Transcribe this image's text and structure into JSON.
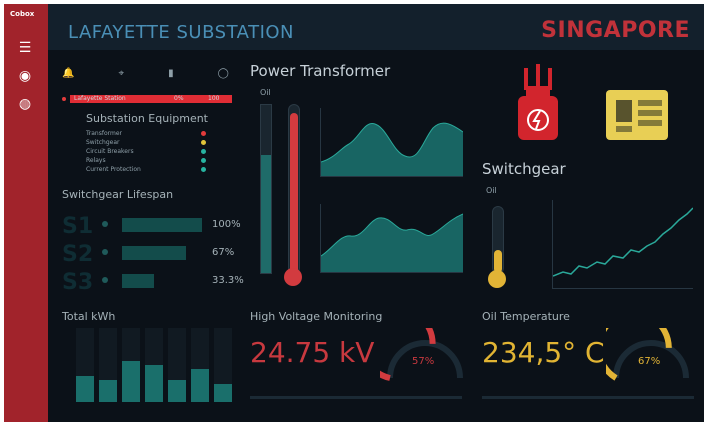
{
  "app": {
    "brand": "Cobox",
    "site_title": "LAFAYETTE SUBSTATION",
    "city": "SINGAPORE"
  },
  "sidebar": {
    "icons": [
      "menu-icon",
      "dashboard-icon",
      "user-icon"
    ]
  },
  "alarms": {
    "header_icons": [
      "bell-icon",
      "location-icon",
      "battery-icon",
      "bulb-icon"
    ],
    "active_row": {
      "name": "Lafayette Station",
      "c1": "0%",
      "c2": "100"
    }
  },
  "substation_equipment": {
    "title": "Substation Equipment",
    "items": [
      {
        "label": "Transformer",
        "color": "#e23b3b"
      },
      {
        "label": "Switchgear",
        "color": "#e0c43a"
      },
      {
        "label": "Circuit Breakers",
        "color": "#27b3a0"
      },
      {
        "label": "Relays",
        "color": "#27b3a0"
      },
      {
        "label": "Current Protection",
        "color": "#27b3a0"
      }
    ]
  },
  "switchgear_lifespan": {
    "title": "Switchgear Lifespan",
    "rows": [
      {
        "id": "S1",
        "value": "100%",
        "fraction": 1.0
      },
      {
        "id": "S2",
        "value": "67%",
        "fraction": 0.67
      },
      {
        "id": "S3",
        "value": "33.3%",
        "fraction": 0.33
      }
    ]
  },
  "total_kwh": {
    "title": "Total kWh",
    "bars": [
      0.35,
      0.3,
      0.55,
      0.5,
      0.3,
      0.45,
      0.25
    ]
  },
  "power_transformer": {
    "title": "Power Transformer",
    "oil_label": "Oil",
    "level_fraction": 0.7,
    "temp_fraction": 0.95
  },
  "switchgear": {
    "title": "Switchgear",
    "oil_label": "Oil",
    "level_fraction": 0.35
  },
  "high_voltage": {
    "title": "High Voltage Monitoring",
    "value": "24.75 kV",
    "gauge_value": "57%",
    "gauge_fraction": 0.57,
    "color": "#d23b3f"
  },
  "oil_temperature": {
    "title": "Oil Temperature",
    "value": "234,5° C",
    "gauge_value": "67%",
    "gauge_fraction": 0.67,
    "color": "#e2b436"
  }
}
